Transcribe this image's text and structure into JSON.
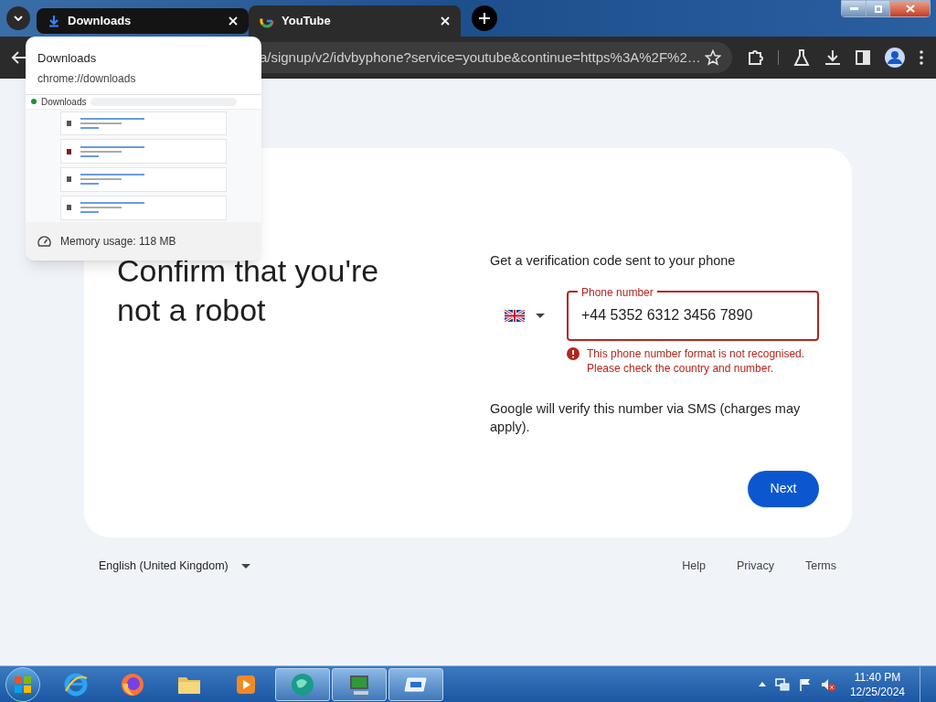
{
  "tabs": [
    {
      "title": "Downloads",
      "kind": "download",
      "selected": false,
      "hovered": true
    },
    {
      "title": "YouTube",
      "kind": "google",
      "selected": true,
      "hovered": false
    }
  ],
  "address_bar": {
    "url": "a/signup/v2/idvbyphone?service=youtube&continue=https%3A%2F%2…"
  },
  "hover_card": {
    "title": "Downloads",
    "url": "chrome://downloads",
    "preview_title": "Downloads",
    "memory": "Memory usage: 118 MB"
  },
  "page": {
    "heading": "Confirm that you're not a robot",
    "prompt": "Get a verification code sent to your phone",
    "phone_field": {
      "label": "Phone number",
      "value": "+44 5352 6312 3456 7890",
      "error": true
    },
    "error_message": "This phone number format is not recognised. Please check the country and number.",
    "note": "Google will verify this number via SMS (charges may apply).",
    "next_button": "Next"
  },
  "footer": {
    "language": "English (United Kingdom)",
    "links": [
      "Help",
      "Privacy",
      "Terms"
    ]
  },
  "taskbar": {
    "apps": [
      {
        "kind": "ie",
        "active": false
      },
      {
        "kind": "firefox",
        "active": false
      },
      {
        "kind": "explorer",
        "active": false
      },
      {
        "kind": "media",
        "active": false
      },
      {
        "kind": "globe",
        "active": true
      },
      {
        "kind": "monitor",
        "active": true
      },
      {
        "kind": "window",
        "active": true
      }
    ],
    "time": "11:40 PM",
    "date": "12/25/2024"
  }
}
